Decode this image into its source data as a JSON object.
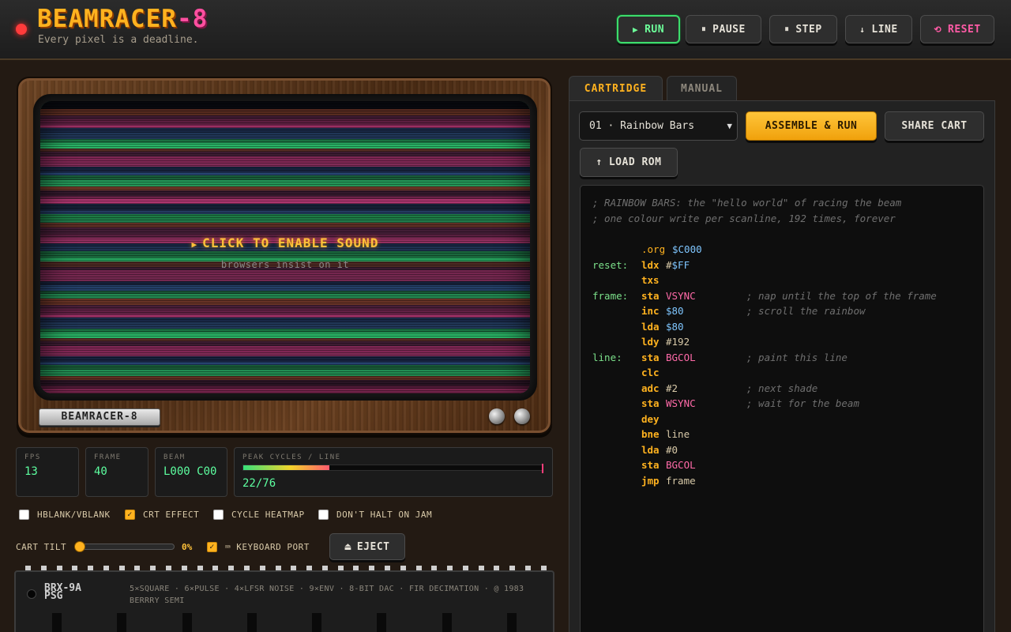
{
  "header": {
    "brand_main": "BEAMRACER",
    "brand_accent": "-8",
    "tagline": "Every pixel is a deadline.",
    "buttons": [
      {
        "label": "RUN",
        "icon": "▶",
        "name": "run-button",
        "cls": "run"
      },
      {
        "label": "PAUSE",
        "icon": "⏸",
        "name": "pause-button",
        "cls": ""
      },
      {
        "label": "STEP",
        "icon": "⏸",
        "name": "step-button",
        "cls": ""
      },
      {
        "label": "LINE",
        "icon": "↓",
        "name": "line-button",
        "cls": ""
      },
      {
        "label": "RESET",
        "icon": "⟲",
        "name": "reset-button",
        "cls": "reset"
      }
    ]
  },
  "tv": {
    "overlay_title": "CLICK TO ENABLE SOUND",
    "overlay_sub": "browsers insist on it",
    "badge": "BEAMRACER-8"
  },
  "stats": {
    "fps": {
      "label": "FPS",
      "value": "13"
    },
    "frame": {
      "label": "FRAME",
      "value": "40"
    },
    "beam": {
      "label": "BEAM",
      "value": "L000 C00"
    },
    "peak": {
      "label": "PEAK CYCLES / LINE",
      "value": "22/76",
      "used": 22,
      "max": 76
    }
  },
  "options": {
    "hblank": {
      "label": "HBLANK/VBLANK",
      "checked": false
    },
    "crt": {
      "label": "CRT EFFECT",
      "checked": true
    },
    "heatmap": {
      "label": "CYCLE HEATMAP",
      "checked": false
    },
    "nohalt": {
      "label": "DON'T HALT ON JAM",
      "checked": false
    },
    "tilt_label": "CART TILT",
    "tilt_value": "0%",
    "tilt_fraction": 0,
    "keyboard": {
      "label": "⌨ KEYBOARD PORT",
      "checked": true
    },
    "eject": "EJECT",
    "eject_icon": "⏏"
  },
  "chip": {
    "name_line1": "BRX-9A",
    "name_line2": "PSG",
    "spec": "5×SQUARE · 6×PULSE · 4×LFSR NOISE · 9×ENV · 8-BIT DAC · FIR DECIMATION · @ 1983 BERRRY SEMI"
  },
  "panel": {
    "tabs": {
      "cartridge": "CARTRIDGE",
      "manual": "MANUAL"
    },
    "select_value": "01 · Rainbow Bars",
    "assemble": "ASSEMBLE & RUN",
    "share": "SHARE CART",
    "load": "LOAD ROM",
    "load_icon": "↑"
  },
  "code": {
    "comments": [
      "; RAINBOW BARS: the \"hello world\" of racing the beam",
      "; one colour write per scanline, 192 times, forever"
    ],
    "lines": [
      {
        "label": "",
        "op": ".org",
        "arg": [
          [
            "hex",
            "$C000"
          ]
        ],
        "cmt": "",
        "dir": true
      },
      {
        "label": "reset:",
        "op": "ldx",
        "arg": [
          [
            "hash",
            "#"
          ],
          [
            "hex",
            "$FF"
          ]
        ],
        "cmt": ""
      },
      {
        "label": "",
        "op": "txs",
        "arg": [],
        "cmt": ""
      },
      {
        "label": "frame:",
        "op": "sta",
        "arg": [
          [
            "sym",
            "VSYNC"
          ]
        ],
        "cmt": "; nap until the top of the frame"
      },
      {
        "label": "",
        "op": "inc",
        "arg": [
          [
            "hex",
            "$80"
          ]
        ],
        "cmt": "; scroll the rainbow"
      },
      {
        "label": "",
        "op": "lda",
        "arg": [
          [
            "hex",
            "$80"
          ]
        ],
        "cmt": ""
      },
      {
        "label": "",
        "op": "ldy",
        "arg": [
          [
            "hash",
            "#"
          ],
          [
            "num",
            "192"
          ]
        ],
        "cmt": ""
      },
      {
        "label": "line:",
        "op": "sta",
        "arg": [
          [
            "sym",
            "BGCOL"
          ]
        ],
        "cmt": "; paint this line"
      },
      {
        "label": "",
        "op": "clc",
        "arg": [],
        "cmt": ""
      },
      {
        "label": "",
        "op": "adc",
        "arg": [
          [
            "hash",
            "#"
          ],
          [
            "num",
            "2"
          ]
        ],
        "cmt": "; next shade"
      },
      {
        "label": "",
        "op": "sta",
        "arg": [
          [
            "sym",
            "WSYNC"
          ]
        ],
        "cmt": "; wait for the beam"
      },
      {
        "label": "",
        "op": "dey",
        "arg": [],
        "cmt": ""
      },
      {
        "label": "",
        "op": "bne",
        "arg": [
          [
            "plain",
            "line"
          ]
        ],
        "cmt": ""
      },
      {
        "label": "",
        "op": "lda",
        "arg": [
          [
            "hash",
            "#"
          ],
          [
            "num",
            "0"
          ]
        ],
        "cmt": ""
      },
      {
        "label": "",
        "op": "sta",
        "arg": [
          [
            "sym",
            "BGCOL"
          ]
        ],
        "cmt": ""
      },
      {
        "label": "",
        "op": "jmp",
        "arg": [
          [
            "plain",
            "frame"
          ]
        ],
        "cmt": ""
      }
    ]
  },
  "colors": {
    "accent": "#ffb21f",
    "accent_pink": "#ff4fa0",
    "run_green": "#3ddc6c",
    "stat_green": "#5dffa0"
  }
}
